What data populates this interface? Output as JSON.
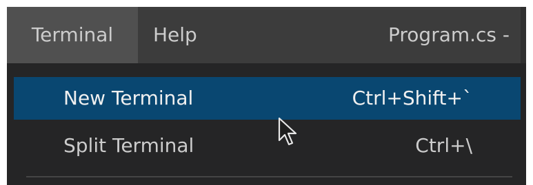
{
  "menubar": {
    "items": [
      {
        "label": "Terminal"
      },
      {
        "label": "Help"
      }
    ],
    "window_title": "Program.cs -"
  },
  "terminal_menu": {
    "items": [
      {
        "label": "New Terminal",
        "shortcut": "Ctrl+Shift+`",
        "highlighted": true
      },
      {
        "label": "Split Terminal",
        "shortcut": "Ctrl+\\",
        "highlighted": false
      }
    ]
  },
  "colors": {
    "menubar_bg": "#3c3c3c",
    "active_menubar_item_bg": "#505050",
    "dropdown_bg": "#252526",
    "highlight_bg": "#094771",
    "text": "#cccccc"
  },
  "icons": {
    "mouse_pointer": "mouse-pointer-icon"
  }
}
